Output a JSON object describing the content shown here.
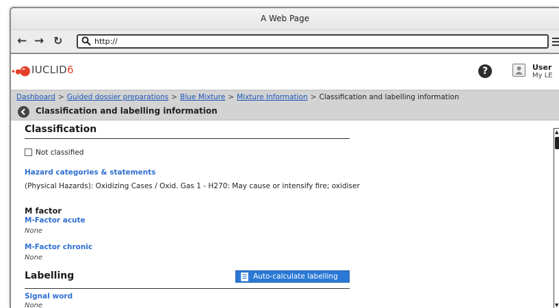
{
  "window": {
    "title": "A Web Page"
  },
  "browser": {
    "url": "http://"
  },
  "app": {
    "logo_text": "IUCLID",
    "logo_version": "6",
    "user_name": "User",
    "user_sub": "My LE"
  },
  "breadcrumb": {
    "items": [
      "Dashboard",
      "Guided dossier preparations",
      "Blue Mixture",
      "Mixture Information"
    ],
    "current": "Classification and labelling information",
    "separator": ">"
  },
  "page": {
    "title": "Classification and labelling information"
  },
  "classification": {
    "heading": "Classification",
    "not_classified_label": "Not classified",
    "hazard_label": "Hazard categories & statements",
    "hazard_text": "(Physical Hazards): Oxidizing Cases / Oxid. Gas 1 - H270: May cause or intensify fire; oxidiser",
    "m_factor_heading": "M factor",
    "m_factor_acute_label": "M-Factor acute",
    "m_factor_acute_value": "None",
    "m_factor_chronic_label": "M-Factor chronic",
    "m_factor_chronic_value": "None"
  },
  "labelling": {
    "heading": "Labelling",
    "auto_button_label": "Auto-calculate labelling",
    "signal_word_label": "Signal word",
    "signal_word_value": "None"
  },
  "colors": {
    "link": "#1b56b8",
    "field_label": "#2f6fd1",
    "button": "#2a79d6",
    "logo_accent": "#e3412a",
    "crumbbar": "#d3d3d3"
  }
}
